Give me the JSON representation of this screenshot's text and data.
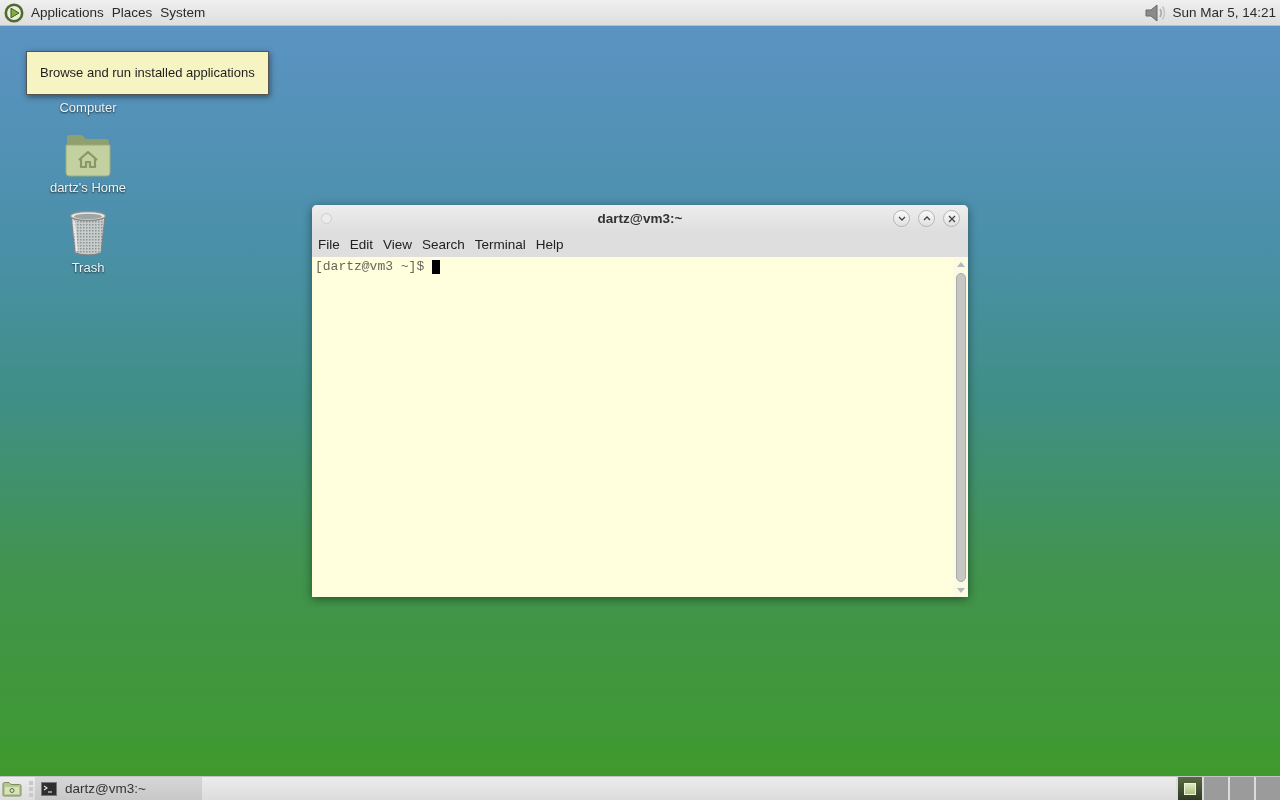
{
  "top_panel": {
    "menus": [
      "Applications",
      "Places",
      "System"
    ],
    "clock": "Sun Mar 5, 14:21"
  },
  "desktop_icons": [
    {
      "kind": "computer",
      "label": "Computer"
    },
    {
      "kind": "home",
      "label": "dartz's Home"
    },
    {
      "kind": "trash",
      "label": "Trash"
    }
  ],
  "tooltip": {
    "text": "Browse and run installed applications"
  },
  "terminal_window": {
    "title": "dartz@vm3:~",
    "menu": [
      "File",
      "Edit",
      "View",
      "Search",
      "Terminal",
      "Help"
    ],
    "prompt": "[dartz@vm3 ~]$"
  },
  "taskbar": {
    "tasks": [
      {
        "label": "dartz@vm3:~",
        "selected": true
      }
    ],
    "workspaces": [
      {
        "selected": true,
        "has_window": true
      },
      {
        "selected": false,
        "has_window": false
      },
      {
        "selected": false,
        "has_window": false
      },
      {
        "selected": false,
        "has_window": false
      }
    ]
  }
}
